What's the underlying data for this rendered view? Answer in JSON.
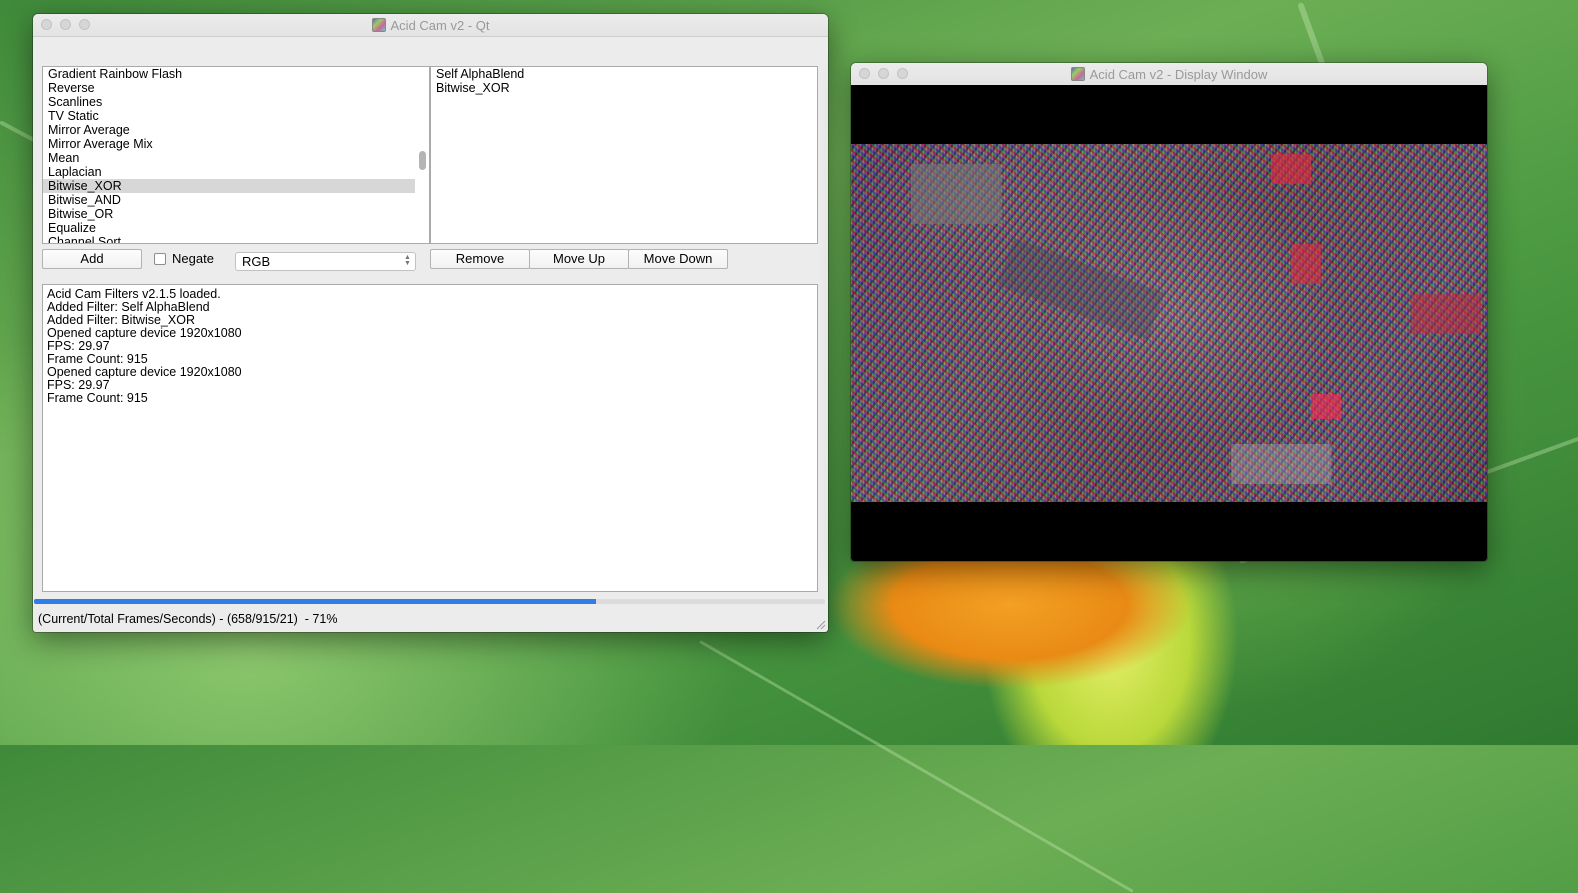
{
  "main_window": {
    "title": "Acid Cam v2 - Qt",
    "filter_list": [
      "Gradient Rainbow Flash",
      "Reverse",
      "Scanlines",
      "TV Static",
      "Mirror Average",
      "Mirror Average Mix",
      "Mean",
      "Laplacian",
      "Bitwise_XOR",
      "Bitwise_AND",
      "Bitwise_OR",
      "Equalize",
      "Channel Sort"
    ],
    "selected_filter": "Bitwise_XOR",
    "active_filters": [
      "Self AlphaBlend",
      "Bitwise_XOR"
    ],
    "buttons": {
      "add": "Add",
      "remove": "Remove",
      "move_up": "Move Up",
      "move_down": "Move Down"
    },
    "negate_label": "Negate",
    "negate_checked": false,
    "color_mode": "RGB",
    "log_lines": [
      "Acid Cam Filters v2.1.5 loaded.",
      "Added Filter: Self AlphaBlend",
      "Added Filter: Bitwise_XOR",
      "Opened capture device 1920x1080",
      "FPS: 29.97",
      "Frame Count: 915",
      "Opened capture device 1920x1080",
      "FPS: 29.97",
      "Frame Count: 915"
    ],
    "progress_percent": 71,
    "status_text": "(Current/Total Frames/Seconds) - (658/915/21)  - 71%"
  },
  "display_window": {
    "title": "Acid Cam v2 - Display Window"
  },
  "colors": {
    "progress": "#2f7ee8",
    "selection": "#d7d7d7",
    "window_bg": "#ececec"
  }
}
